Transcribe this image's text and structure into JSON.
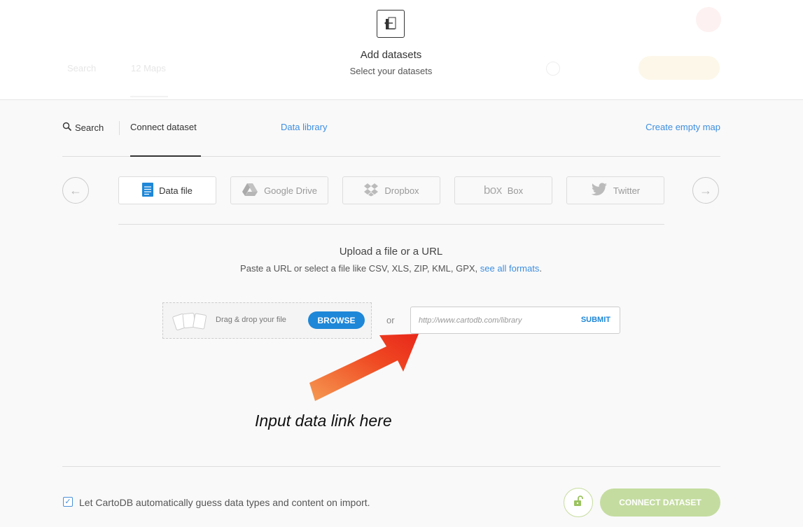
{
  "header": {
    "title": "Add datasets",
    "subtitle": "Select your datasets",
    "icon": "add-dataset-icon",
    "background_texts": [
      "Search",
      "12 Maps"
    ]
  },
  "tabs": {
    "search": "Search",
    "connect": "Connect dataset",
    "library": "Data library",
    "empty_map": "Create empty map"
  },
  "sources": [
    {
      "label": "Data file",
      "icon": "data-file-icon",
      "active": true
    },
    {
      "label": "Google Drive",
      "icon": "google-drive-icon",
      "active": false
    },
    {
      "label": "Dropbox",
      "icon": "dropbox-icon",
      "active": false
    },
    {
      "label": "Box",
      "icon": "box-icon",
      "logo_text": "box",
      "active": false
    },
    {
      "label": "Twitter",
      "icon": "twitter-icon",
      "active": false
    }
  ],
  "upload": {
    "title": "Upload a file or a URL",
    "description": "Paste a URL or select a file like CSV, XLS, ZIP, KML, GPX, ",
    "formats_link": "see all formats",
    "description_end": ".",
    "drop_text": "Drag & drop your file",
    "browse_label": "BROWSE",
    "or_text": "or",
    "url_placeholder": "http://www.cartodb.com/library",
    "submit_label": "SUBMIT"
  },
  "annotation": {
    "text": "Input data link here"
  },
  "footer": {
    "guess_label": "Let CartoDB automatically guess data types and content on import.",
    "guess_checked": true,
    "connect_label": "CONNECT DATASET"
  },
  "colors": {
    "link": "#3d8ee0",
    "primary": "#1e87d8",
    "connect_disabled": "#c4dca0",
    "annotation_arrow": "#f04a23"
  }
}
